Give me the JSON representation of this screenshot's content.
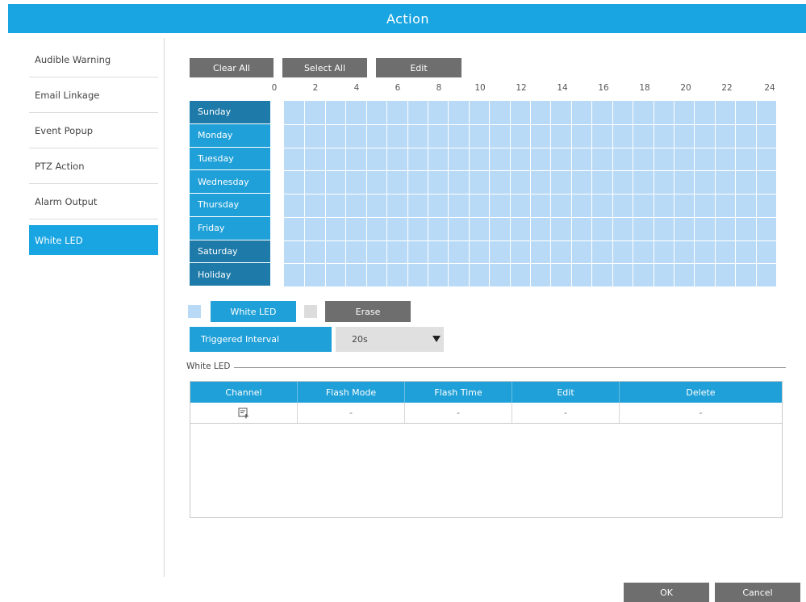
{
  "window": {
    "title": "Action"
  },
  "sidebar": {
    "items": [
      {
        "label": "Audible Warning",
        "active": false
      },
      {
        "label": "Email Linkage",
        "active": false
      },
      {
        "label": "Event Popup",
        "active": false
      },
      {
        "label": "PTZ Action",
        "active": false
      },
      {
        "label": "Alarm Output",
        "active": false
      },
      {
        "label": "White LED",
        "active": true
      }
    ]
  },
  "toolbar": {
    "clear_all": "Clear All",
    "select_all": "Select All",
    "edit": "Edit"
  },
  "schedule": {
    "hours": [
      "0",
      "2",
      "4",
      "6",
      "8",
      "10",
      "12",
      "14",
      "16",
      "18",
      "20",
      "22",
      "24"
    ],
    "days": [
      "Sunday",
      "Monday",
      "Tuesday",
      "Wednesday",
      "Thursday",
      "Friday",
      "Saturday",
      "Holiday"
    ],
    "cell_color": "#b9daf6"
  },
  "legend": {
    "white_led_label": "White LED",
    "erase_label": "Erase",
    "white_led_swatch_color": "#b9daf6",
    "erase_swatch_color": "#dcdcdc"
  },
  "triggered_interval": {
    "label": "Triggered Interval",
    "value": "20s"
  },
  "white_led_section": {
    "legend": "White LED",
    "columns": [
      "Channel",
      "Flash Mode",
      "Flash Time",
      "Edit",
      "Delete"
    ],
    "rows": [
      {
        "channel_icon": "add-channel-icon",
        "flash_mode": "-",
        "flash_time": "-",
        "edit": "-",
        "delete": "-"
      }
    ]
  },
  "footer": {
    "ok": "OK",
    "cancel": "Cancel"
  },
  "colors": {
    "accent": "#19a5e2",
    "button_gray": "#6e6e6e",
    "day_dark": "#1d7aa9"
  }
}
